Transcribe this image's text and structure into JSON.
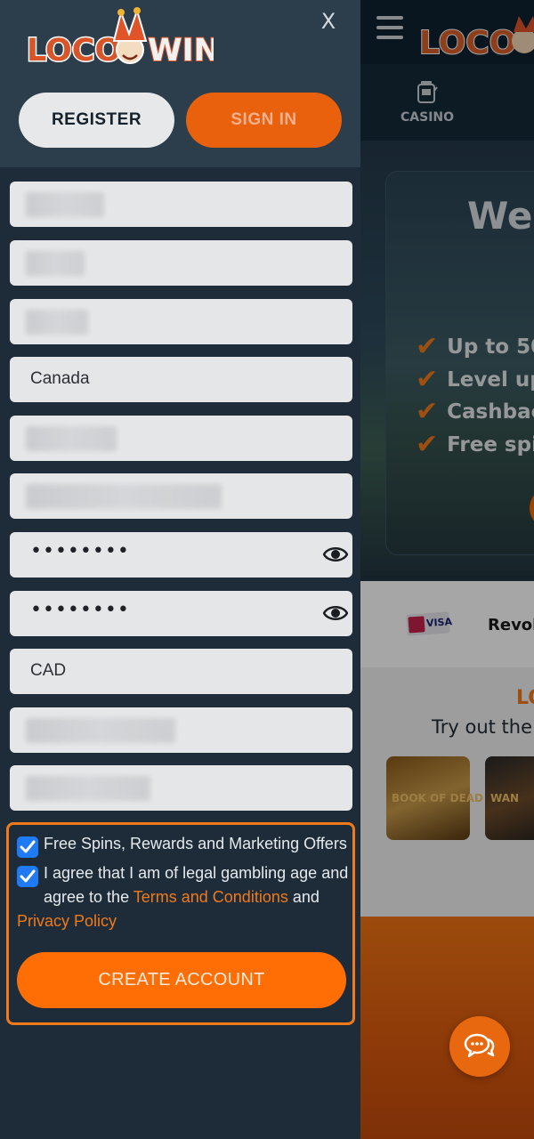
{
  "drawer": {
    "logo_text_left": "LOCO",
    "logo_text_right": "WIN",
    "close_label": "X",
    "register_label": "REGISTER",
    "signin_label": "SIGN IN"
  },
  "form": {
    "country_value": "Canada",
    "password_value": "••••••••",
    "confirm_password_value": "••••••••",
    "currency_value": "CAD"
  },
  "consent": {
    "marketing_label": "Free Spins, Rewards and Marketing Offers",
    "marketing_checked": true,
    "terms_prefix_line1": "I agree that I am of legal gambling age and",
    "terms_prefix_line2": "agree to the ",
    "terms_link": "Terms and Conditions",
    "terms_and": " and",
    "privacy_link": "Privacy Policy",
    "terms_checked": true,
    "create_account_label": "CREATE ACCOUNT"
  },
  "background_page": {
    "casino_tab_label": "CASINO",
    "hero_title": "Wel",
    "hero_checks": [
      "Up to 50",
      "Level up",
      "Cashbac",
      "Free spi"
    ],
    "payment_visa": "VISA",
    "payment_revolut": "Revol",
    "games_heading": "LO",
    "games_subheading": "Try out the",
    "game_1_title": "BOOK OF DEAD",
    "game_2_title": "WAN"
  },
  "colors": {
    "accent_orange": "#f07a1a",
    "button_orange": "#ff6e05",
    "checkbox_blue": "#1e7bf5",
    "drawer_bg": "#1e2c39"
  }
}
